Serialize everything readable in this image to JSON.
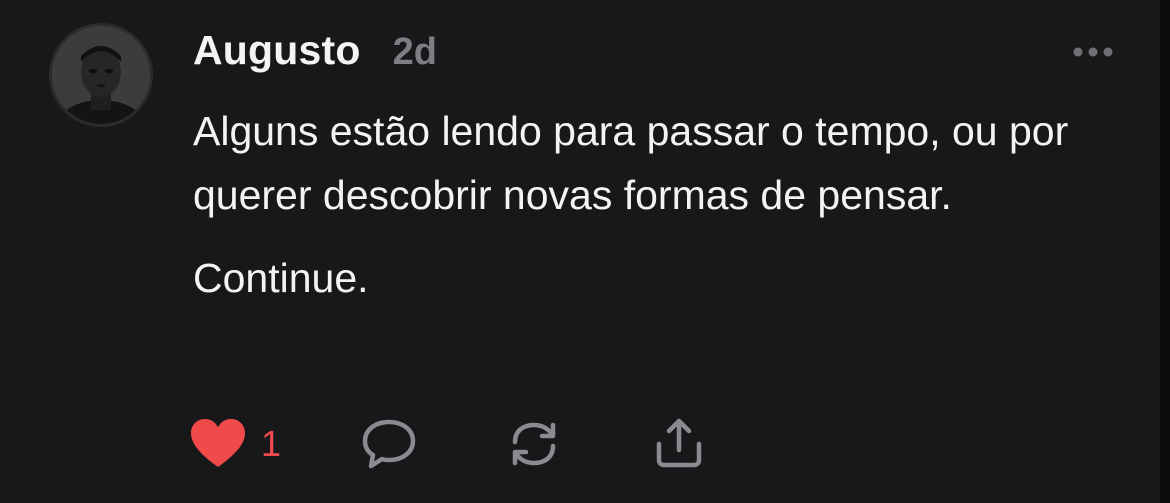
{
  "post": {
    "author": "Augusto",
    "timestamp": "2d",
    "paragraphs": [
      "Alguns estão lendo para passar o tempo, ou por querer descobrir novas formas de pensar.",
      "Continue."
    ],
    "actions": {
      "like_count": "1",
      "liked": true
    }
  },
  "colors": {
    "background": "#18181a",
    "text": "#f3f3f3",
    "muted": "#7e7e82",
    "like": "#f04a4a"
  },
  "icons": {
    "more": "more-horizontal-icon",
    "like": "heart-icon",
    "reply": "comment-bubble-icon",
    "repost": "repost-arrows-icon",
    "share": "share-upload-icon"
  }
}
